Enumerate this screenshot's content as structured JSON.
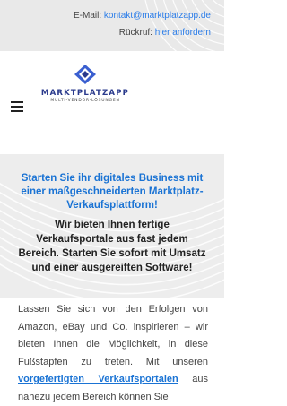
{
  "topbar": {
    "email_label": "E-Mail:",
    "email_link": "kontakt@marktplatzapp.de",
    "callback_label": "Rückruf:",
    "callback_link": "hier anfordern"
  },
  "header": {
    "logo_title": "MARKTPLATZAPP",
    "logo_subtitle": "MULTI-VENDOR-LÖSUNGEN",
    "menu_icon": "hamburger-menu-icon"
  },
  "hero": {
    "title": "Starten Sie ihr digitales Business mit einer maßgeschneiderten Marktplatz-Verkaufsplattform!",
    "subtitle": "Wir bieten Ihnen fertige Verkaufsportale aus fast jedem Bereich. Starten Sie sofort mit Umsatz und einer ausgereiften Software!"
  },
  "body": {
    "text_before_link": "Lassen Sie sich von den Erfolgen von Amazon, eBay und Co. inspirieren – wir bieten Ihnen die Möglichkeit, in diese Fußstapfen zu treten. Mit unseren ",
    "link": "vorgefertigten Verkaufsportalen",
    "text_after_link": " aus nahezu jedem Bereich können Sie"
  },
  "colors": {
    "accent": "#1a73d4",
    "brand": "#2a3a8c",
    "topbar_bg": "#e9e9e9",
    "hero_bg": "#ededed"
  }
}
